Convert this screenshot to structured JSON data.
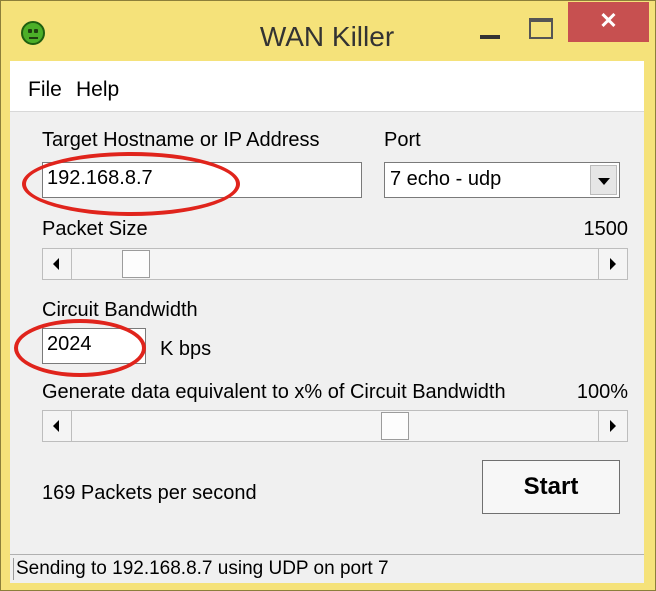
{
  "window": {
    "title": "WAN Killer",
    "close_label": "✕"
  },
  "menu": {
    "items": [
      "File",
      "Help"
    ]
  },
  "form": {
    "target_label": "Target Hostname or IP Address",
    "target_value": "192.168.8.7",
    "port_label": "Port",
    "port_value": "7 echo - udp",
    "packet_size_label": "Packet Size",
    "packet_size_value": "1500",
    "packet_size_slider_fraction": 0.1,
    "bandwidth_label": "Circuit Bandwidth",
    "bandwidth_value": "2024",
    "bandwidth_unit": "K bps",
    "percent_label": "Generate data equivalent to x% of Circuit Bandwidth",
    "percent_value": "100%",
    "percent_slider_fraction": 0.62,
    "packets_per_second": "169 Packets per second",
    "start_label": "Start"
  },
  "status": {
    "text": "Sending to 192.168.8.7 using UDP on port 7"
  },
  "colors": {
    "titlebar": "#f5e27a",
    "close_button": "#c75050",
    "annotation": "#e0241c"
  }
}
